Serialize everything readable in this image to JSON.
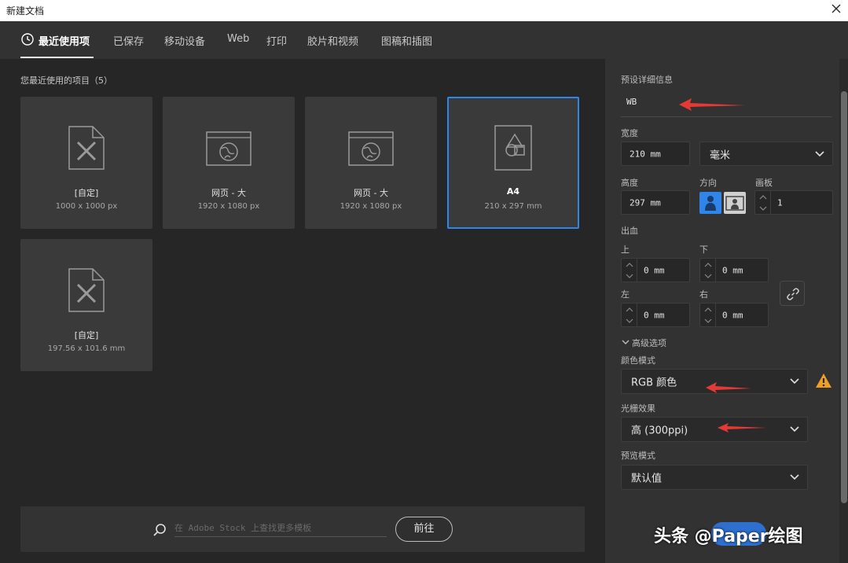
{
  "window": {
    "title": "新建文档"
  },
  "tabs": [
    {
      "label": "最近使用项",
      "active": true
    },
    {
      "label": "已保存"
    },
    {
      "label": "移动设备"
    },
    {
      "label": "Web"
    },
    {
      "label": "打印"
    },
    {
      "label": "胶片和视频"
    },
    {
      "label": "图稿和插图"
    }
  ],
  "recent": {
    "heading": "您最近使用的项目（5）",
    "items": [
      {
        "name": "[自定]",
        "dims": "1000 x 1000 px",
        "icon": "custom-doc-icon"
      },
      {
        "name": "网页 - 大",
        "dims": "1920 x 1080 px",
        "icon": "web-page-icon"
      },
      {
        "name": "网页 - 大",
        "dims": "1920 x 1080 px",
        "icon": "web-page-icon"
      },
      {
        "name": "A4",
        "dims": "210 x 297 mm",
        "icon": "shapes-doc-icon",
        "selected": true
      },
      {
        "name": "[自定]",
        "dims": "197.56 x 101.6 mm",
        "icon": "custom-doc-icon"
      }
    ]
  },
  "search": {
    "placeholder": "在 Adobe Stock 上查找更多模板",
    "go_label": "前往"
  },
  "details": {
    "heading": "预设详细信息",
    "preset_name": "WB",
    "width_label": "宽度",
    "width_value": "210 mm",
    "unit_value": "毫米",
    "height_label": "高度",
    "height_value": "297 mm",
    "orientation_label": "方向",
    "artboards_label": "画板",
    "artboards_value": "1",
    "bleed_label": "出血",
    "bleed_top_label": "上",
    "bleed_top_value": "0 mm",
    "bleed_bottom_label": "下",
    "bleed_bottom_value": "0 mm",
    "bleed_left_label": "左",
    "bleed_left_value": "0 mm",
    "bleed_right_label": "右",
    "bleed_right_value": "0 mm",
    "advanced_label": "高级选项",
    "color_mode_label": "颜色模式",
    "color_mode_value": "RGB 颜色",
    "raster_label": "光栅效果",
    "raster_value": "高 (300ppi)",
    "preview_label": "预览模式",
    "preview_value": "默认值"
  },
  "watermark": {
    "text": "头条 @Paper绘图"
  },
  "colors": {
    "accent": "#2f86e8",
    "arrow": "#e53935",
    "warning": "#f0a020"
  }
}
